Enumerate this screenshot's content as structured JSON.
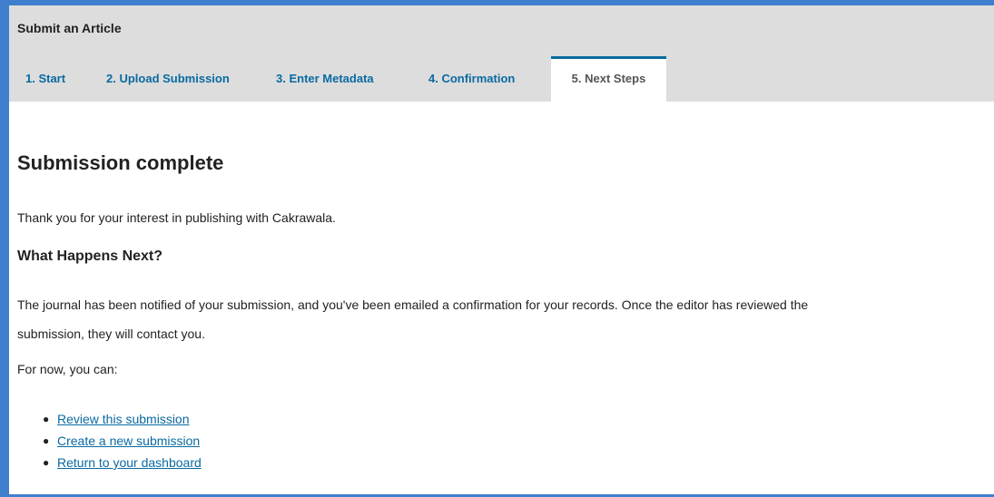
{
  "header": {
    "title": "Submit an Article"
  },
  "tabs": [
    {
      "label": "1. Start"
    },
    {
      "label": "2. Upload Submission"
    },
    {
      "label": "3. Enter Metadata"
    },
    {
      "label": "4. Confirmation"
    },
    {
      "label": "5. Next Steps",
      "active": true
    }
  ],
  "content": {
    "heading": "Submission complete",
    "thanks": "Thank you for your interest in publishing with Cakrawala.",
    "next_heading": "What Happens Next?",
    "body_line1": "The journal has been notified of your submission, and you've been emailed a confirmation for your records. Once the editor has reviewed the",
    "body_line2": "submission, they will contact you.",
    "for_now": "For now, you can:",
    "actions": [
      {
        "label": "Review this submission"
      },
      {
        "label": "Create a new submission"
      },
      {
        "label": "Return to your dashboard"
      }
    ]
  },
  "colors": {
    "frame": "#3f7fce",
    "link": "#0a6aa1",
    "header_bg": "#dddddd"
  }
}
